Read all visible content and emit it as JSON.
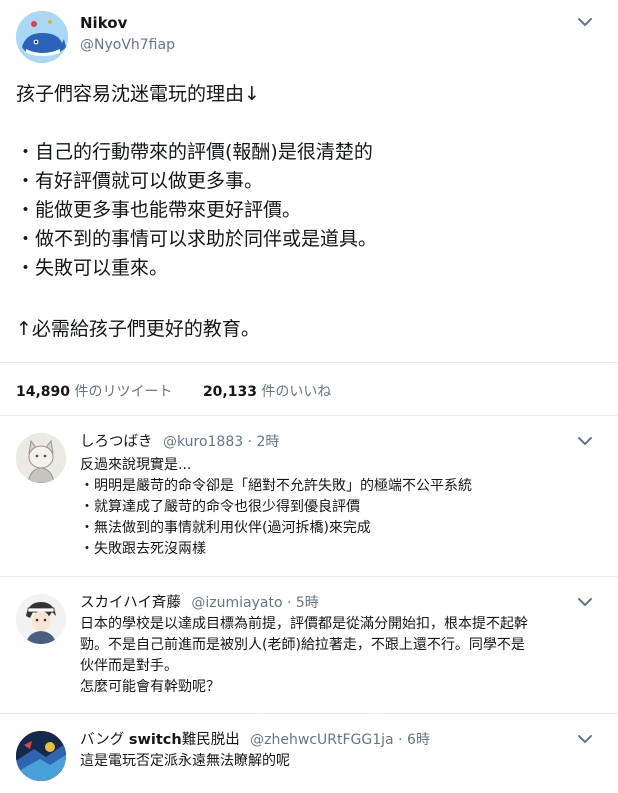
{
  "main_tweet": {
    "author_name": "Nikov",
    "author_handle": "@NyoVh7fiap",
    "text_lines": [
      "孩子們容易沈迷電玩的理由↓",
      "",
      "・自己的行動帶來的評價(報酬)是很清楚的",
      "・有好評價就可以做更多事。",
      "・能做更多事也能帶來更好評價。",
      "・做不到的事情可以求助於同伴或是道具。",
      "・失敗可以重來。",
      "",
      "↑必需給孩子們更好的教育。"
    ],
    "retweet_count": "14,890",
    "retweet_label": "件のリツイート",
    "like_count": "20,133",
    "like_label": "件のいいね"
  },
  "replies": [
    {
      "name": "しろつばき",
      "handle": "@kuro1883",
      "time": "2時",
      "lines": [
        "反過來說現實是...",
        "・明明是嚴苛的命令卻是「絕對不允許失敗」的極端不公平系統",
        "・就算達成了嚴苛的命令也很少得到優良評價",
        "・無法做到的事情就利用伙伴(過河拆橋)來完成",
        "・失敗跟去死沒兩樣"
      ]
    },
    {
      "name": "スカイハイ斉藤",
      "handle": "@izumiayato",
      "time": "5時",
      "lines": [
        "日本的學校是以達成目標為前提，評價都是從滿分開始扣，根本提不起幹",
        "勁。不是自己前進而是被別人(老師)給拉著走，不跟上還不行。同學不是",
        "伙伴而是對手。",
        "怎麼可能會有幹勁呢？"
      ]
    },
    {
      "name_prefix": "バング ",
      "name_bold": "switch",
      "name_suffix": "難民脱出",
      "handle": "@zhehwcURtFGG1ja",
      "time": "6時",
      "lines": [
        "這是電玩否定派永遠無法瞭解的呢"
      ]
    }
  ],
  "separator": "·",
  "colors": {
    "text": "#14171a",
    "secondary": "#657786",
    "divider": "#e6ecf0"
  }
}
